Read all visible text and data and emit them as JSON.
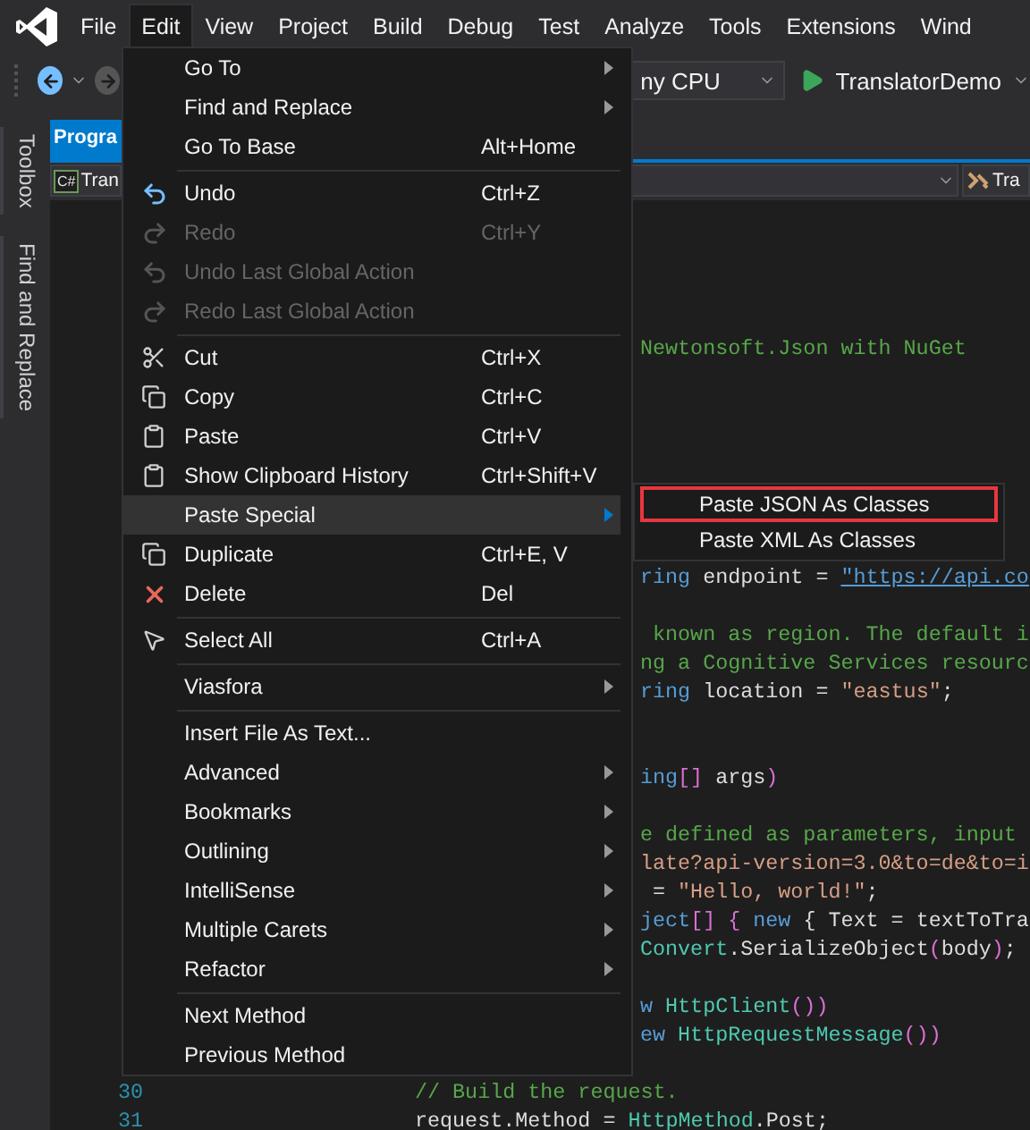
{
  "menu_bar": {
    "items": [
      {
        "label": "File",
        "selected": false
      },
      {
        "label": "Edit",
        "selected": true
      },
      {
        "label": "View",
        "selected": false
      },
      {
        "label": "Project",
        "selected": false
      },
      {
        "label": "Build",
        "selected": false
      },
      {
        "label": "Debug",
        "selected": false
      },
      {
        "label": "Test",
        "selected": false
      },
      {
        "label": "Analyze",
        "selected": false
      },
      {
        "label": "Tools",
        "selected": false
      },
      {
        "label": "Extensions",
        "selected": false
      },
      {
        "label": "Wind",
        "selected": false
      }
    ]
  },
  "toolbar": {
    "platform": "ny CPU",
    "start_project": "TranslatorDemo"
  },
  "side_tabs": [
    "Toolbox",
    "Find and Replace"
  ],
  "document_tabs": [
    {
      "label": "Progra",
      "selected": true
    }
  ],
  "nav_bar": {
    "file_badge": "C#",
    "project": "Tran",
    "member": "Tra"
  },
  "editor": {
    "lines": [
      {
        "kind": "blank"
      },
      {
        "kind": "blank"
      },
      {
        "kind": "blank"
      },
      {
        "kind": "blank"
      },
      {
        "kind": "partial",
        "tokens": [
          {
            "kind": "comment",
            "text": "Newtonsoft.Json with NuGet"
          }
        ]
      },
      {
        "kind": "blank"
      },
      {
        "kind": "blank"
      },
      {
        "kind": "blank"
      },
      {
        "kind": "blank"
      },
      {
        "kind": "blank"
      },
      {
        "kind": "blank"
      },
      {
        "kind": "blank"
      },
      {
        "kind": "partial",
        "tokens": [
          {
            "kind": "keyword",
            "text": "ring"
          },
          {
            "kind": "plain",
            "text": " endpoint = "
          },
          {
            "kind": "link",
            "text": "\"https://api.co"
          }
        ]
      },
      {
        "kind": "blank"
      },
      {
        "kind": "partial",
        "tokens": [
          {
            "kind": "comment",
            "text": " known as region. The default i"
          }
        ]
      },
      {
        "kind": "partial",
        "tokens": [
          {
            "kind": "comment",
            "text": "ng a Cognitive Services resourc"
          }
        ]
      },
      {
        "kind": "partial",
        "tokens": [
          {
            "kind": "keyword",
            "text": "ring"
          },
          {
            "kind": "plain",
            "text": " location = "
          },
          {
            "kind": "string",
            "text": "\"eastus\""
          },
          {
            "kind": "plain",
            "text": ";"
          }
        ]
      },
      {
        "kind": "blank"
      },
      {
        "kind": "blank"
      },
      {
        "kind": "partial",
        "tokens": [
          {
            "kind": "keyword",
            "text": "ing"
          },
          {
            "kind": "bracket",
            "text": "[]"
          },
          {
            "kind": "plain",
            "text": " args"
          },
          {
            "kind": "bracket",
            "text": ")"
          }
        ]
      },
      {
        "kind": "blank"
      },
      {
        "kind": "partial",
        "tokens": [
          {
            "kind": "comment",
            "text": "e defined as parameters, input"
          }
        ]
      },
      {
        "kind": "partial",
        "tokens": [
          {
            "kind": "string",
            "text": "late?api-version=3.0&to=de&to=i"
          }
        ]
      },
      {
        "kind": "partial",
        "tokens": [
          {
            "kind": "plain",
            "text": " = "
          },
          {
            "kind": "string",
            "text": "\"Hello, world!\""
          },
          {
            "kind": "plain",
            "text": ";"
          }
        ]
      },
      {
        "kind": "partial",
        "tokens": [
          {
            "kind": "keyword",
            "text": "ject"
          },
          {
            "kind": "bracket",
            "text": "[] {"
          },
          {
            "kind": "keyword",
            "text": " new"
          },
          {
            "kind": "plain",
            "text": " { Text = textToTra"
          }
        ]
      },
      {
        "kind": "partial",
        "tokens": [
          {
            "kind": "type",
            "text": "Convert"
          },
          {
            "kind": "plain",
            "text": ".SerializeObject"
          },
          {
            "kind": "bracket",
            "text": "("
          },
          {
            "kind": "plain",
            "text": "body"
          },
          {
            "kind": "bracket",
            "text": ")"
          },
          {
            "kind": "plain",
            "text": ";"
          }
        ]
      },
      {
        "kind": "blank"
      },
      {
        "kind": "partial",
        "tokens": [
          {
            "kind": "keyword",
            "text": "w"
          },
          {
            "kind": "type",
            "text": " HttpClient"
          },
          {
            "kind": "bracket",
            "text": "())"
          }
        ]
      },
      {
        "kind": "partial",
        "tokens": [
          {
            "kind": "keyword",
            "text": "ew"
          },
          {
            "kind": "type",
            "text": " HttpRequestMessage"
          },
          {
            "kind": "bracket",
            "text": "())"
          }
        ]
      },
      {
        "kind": "blank"
      },
      {
        "kind": "full",
        "number": "30",
        "tokens": [
          {
            "kind": "comment",
            "text": "// Build the request."
          }
        ]
      },
      {
        "kind": "full",
        "number": "31",
        "tokens": [
          {
            "kind": "plain",
            "text": "request.Method = "
          },
          {
            "kind": "type",
            "text": "HttpMethod"
          },
          {
            "kind": "plain",
            "text": ".Post;"
          }
        ]
      }
    ]
  },
  "edit_menu": {
    "items": [
      {
        "kind": "item",
        "label": "Go To",
        "submenu": true,
        "disabled": false,
        "selected": false
      },
      {
        "kind": "item",
        "label": "Find and Replace",
        "submenu": true,
        "disabled": false,
        "selected": false
      },
      {
        "kind": "item",
        "label": "Go To Base",
        "shortcut": "Alt+Home",
        "disabled": false,
        "selected": false
      },
      {
        "kind": "separator"
      },
      {
        "kind": "item",
        "label": "Undo",
        "shortcut": "Ctrl+Z",
        "disabled": false,
        "selected": false
      },
      {
        "kind": "item",
        "label": "Redo",
        "shortcut": "Ctrl+Y",
        "disabled": true,
        "selected": false
      },
      {
        "kind": "item",
        "label": "Undo Last Global Action",
        "disabled": true,
        "selected": false
      },
      {
        "kind": "item",
        "label": "Redo Last Global Action",
        "disabled": true,
        "selected": false
      },
      {
        "kind": "separator"
      },
      {
        "kind": "item",
        "label": "Cut",
        "shortcut": "Ctrl+X",
        "disabled": false,
        "selected": false
      },
      {
        "kind": "item",
        "label": "Copy",
        "shortcut": "Ctrl+C",
        "disabled": false,
        "selected": false
      },
      {
        "kind": "item",
        "label": "Paste",
        "shortcut": "Ctrl+V",
        "disabled": false,
        "selected": false
      },
      {
        "kind": "item",
        "label": "Show Clipboard History",
        "shortcut": "Ctrl+Shift+V",
        "disabled": false,
        "selected": false
      },
      {
        "kind": "item",
        "label": "Paste Special",
        "submenu": true,
        "disabled": false,
        "selected": true
      },
      {
        "kind": "item",
        "label": "Duplicate",
        "shortcut": "Ctrl+E, V",
        "disabled": false,
        "selected": false
      },
      {
        "kind": "item",
        "label": "Delete",
        "shortcut": "Del",
        "disabled": false,
        "selected": false
      },
      {
        "kind": "separator"
      },
      {
        "kind": "item",
        "label": "Select All",
        "shortcut": "Ctrl+A",
        "disabled": false,
        "selected": false
      },
      {
        "kind": "separator"
      },
      {
        "kind": "item",
        "label": "Viasfora",
        "submenu": true,
        "disabled": false,
        "selected": false
      },
      {
        "kind": "separator"
      },
      {
        "kind": "item",
        "label": "Insert File As Text...",
        "disabled": false,
        "selected": false
      },
      {
        "kind": "item",
        "label": "Advanced",
        "submenu": true,
        "disabled": false,
        "selected": false
      },
      {
        "kind": "item",
        "label": "Bookmarks",
        "submenu": true,
        "disabled": false,
        "selected": false
      },
      {
        "kind": "item",
        "label": "Outlining",
        "submenu": true,
        "disabled": false,
        "selected": false
      },
      {
        "kind": "item",
        "label": "IntelliSense",
        "submenu": true,
        "disabled": false,
        "selected": false
      },
      {
        "kind": "item",
        "label": "Multiple Carets",
        "submenu": true,
        "disabled": false,
        "selected": false
      },
      {
        "kind": "item",
        "label": "Refactor",
        "submenu": true,
        "disabled": false,
        "selected": false
      },
      {
        "kind": "separator"
      },
      {
        "kind": "item",
        "label": "Next Method",
        "disabled": false,
        "selected": false
      },
      {
        "kind": "item",
        "label": "Previous Method",
        "disabled": false,
        "selected": false
      }
    ]
  },
  "paste_special_menu": {
    "items": [
      {
        "label": "Paste JSON As Classes",
        "highlighted": true
      },
      {
        "label": "Paste XML As Classes",
        "highlighted": false
      }
    ]
  }
}
